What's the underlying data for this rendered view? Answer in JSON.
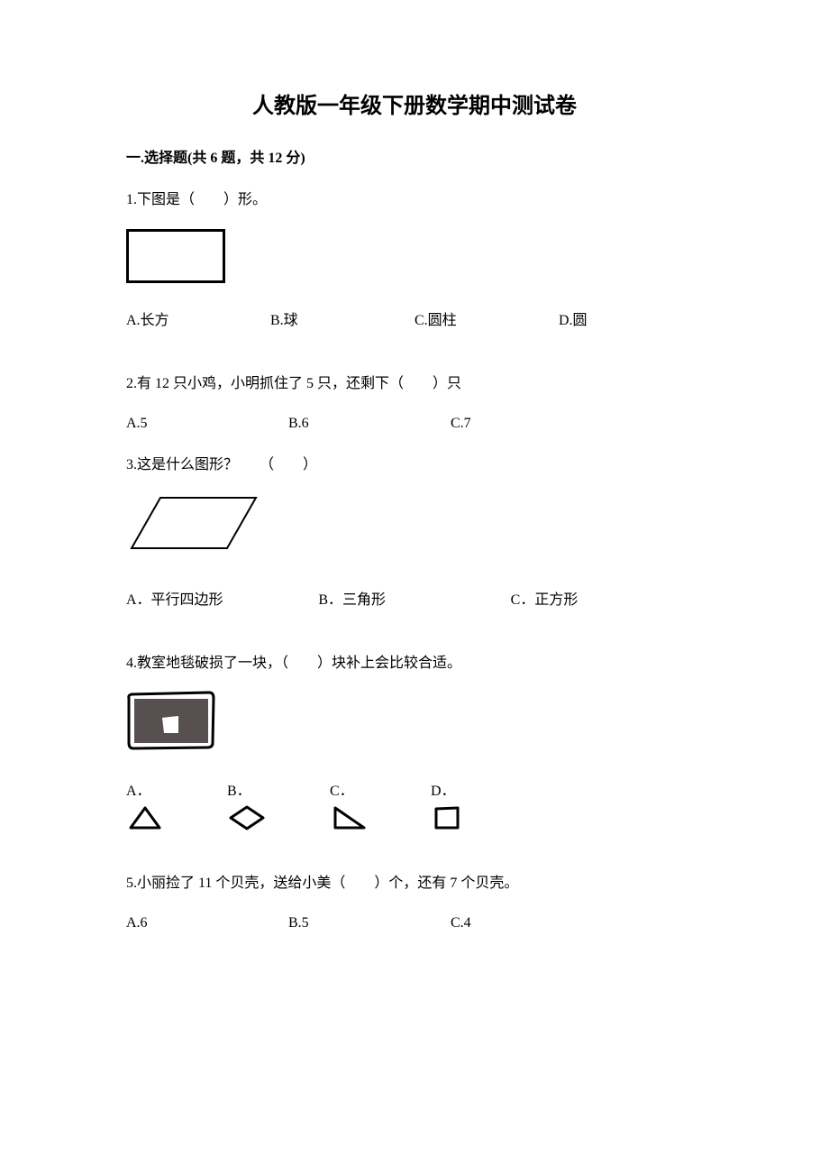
{
  "title": "人教版一年级下册数学期中测试卷",
  "section1": {
    "head": "一.选择题(共 6 题，共 12 分)",
    "q1": {
      "text": "1.下图是（　　）形。",
      "a": "A.长方",
      "b": "B.球",
      "c": "C.圆柱",
      "d": "D.圆"
    },
    "q2": {
      "text": "2.有 12 只小鸡，小明抓住了 5 只，还剩下（　　）只",
      "a": "A.5",
      "b": "B.6",
      "c": "C.7"
    },
    "q3": {
      "text": "3.这是什么图形？　　（　　）",
      "a": "A．平行四边形",
      "b": "B．三角形",
      "c": "C．正方形"
    },
    "q4": {
      "text": "4.教室地毯破损了一块，（　　）块补上会比较合适。",
      "a": "A．",
      "b": "B．",
      "c": "C．",
      "d": "D．"
    },
    "q5": {
      "text": "5.小丽捡了 11 个贝壳，送给小美（　　）个，还有 7 个贝壳。",
      "a": "A.6",
      "b": "B.5",
      "c": "C.4"
    }
  }
}
